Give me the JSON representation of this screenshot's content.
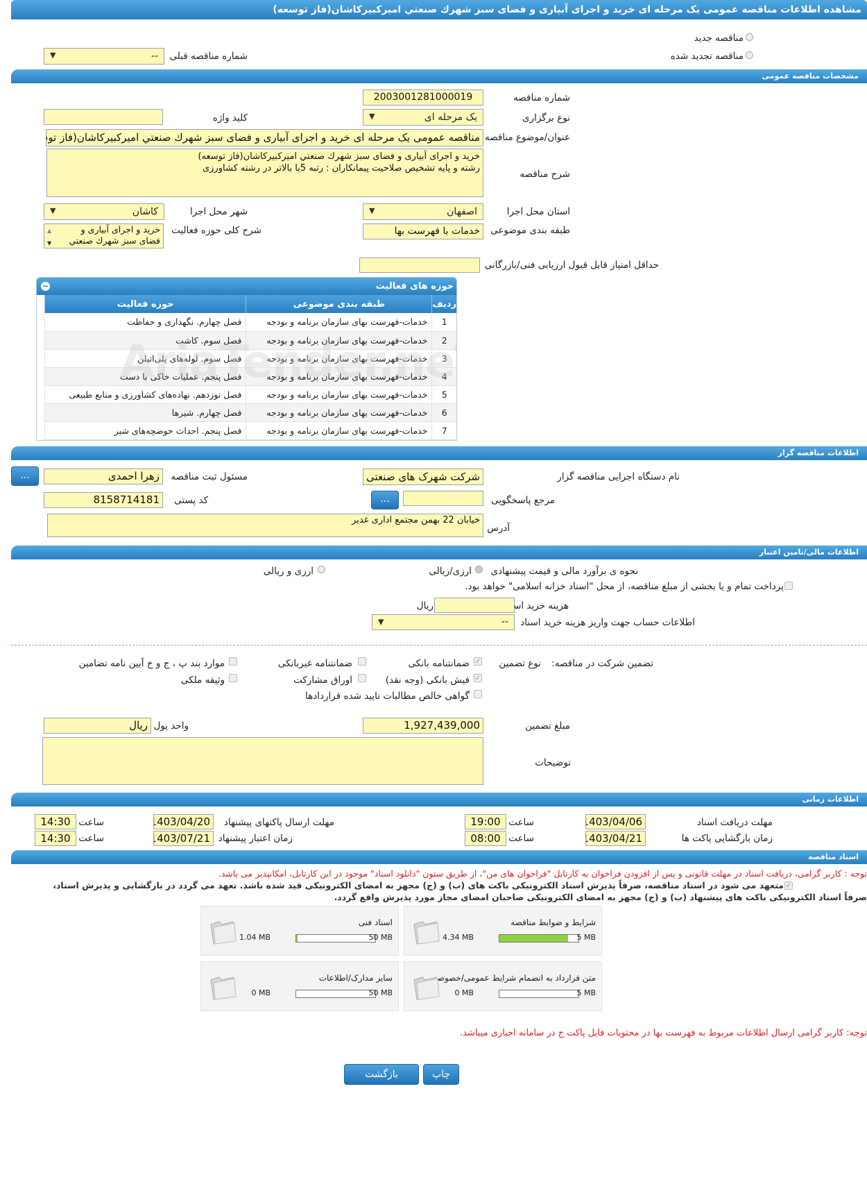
{
  "header": {
    "title": "مشاهده اطلاعات مناقصه عمومی یک مرحله ای خرید و اجرای آبیاری و فضای سبز شهرك صنعتي اميركبيركاشان(فاز توسعه)"
  },
  "mode": {
    "new": "مناقصه جدید",
    "renewed": "مناقصه تجدید شده",
    "prev_label": "شماره مناقصه قبلی",
    "prev_value": "--"
  },
  "general": {
    "section": "مشخصات مناقصه عمومی",
    "number_label": "شماره مناقصه",
    "number": "2003001281000019",
    "type_label": "نوع برگزاری",
    "type": "یک مرحله ای",
    "keyword_label": "کلید واژه",
    "keyword": "",
    "subject_label": "عنوان/موضوع مناقصه",
    "subject": "مناقصه عمومی یک مرحله ای خرید و اجرای آبیاری و فضای سبز شهرك صنعتي اميركبيركاشان(فاز توسعه)",
    "desc_label": "شرح مناقصه",
    "desc_line1": "خرید و اجرای آبیاری و فضای سبز شهرك صنعتي اميركبيركاشان(فاز توسعه)",
    "desc_line2": "رشته و پایه تشخیص صلاحیت پیمانکاران : رتبه 5یا بالاتر در رشته کشاورزی",
    "province_label": "استان محل اجرا",
    "province": "اصفهان",
    "city_label": "شهر محل اجرا",
    "city": "کاشان",
    "category_label": "طبقه بندی موضوعی",
    "category": "خدمات با فهرست بها",
    "activity_label": "شرح کلی حوزه فعالیت",
    "activity_line1": "خرید و اجرای آبیاری و",
    "activity_line2": "فضای سبز شهرك صنعتي",
    "min_score_label": "حداقل امتیاز قابل قبول ارزیابی فنی/بازرگانی",
    "min_score": ""
  },
  "activities": {
    "title": "حوزه های فعالیت",
    "headers": [
      "ردیف",
      "طبقه بندی موضوعی",
      "حوزه فعالیت"
    ],
    "rows": [
      [
        "1",
        "خدمات-فهرست بهای سازمان برنامه و بودجه",
        "فصل چهارم. نگهداری و حفاظت"
      ],
      [
        "2",
        "خدمات-فهرست بهای سازمان برنامه و بودجه",
        "فصل سوم. کاشت"
      ],
      [
        "3",
        "خدمات-فهرست بهای سازمان برنامه و بودجه",
        "فصل سوم. لوله‌های پلی‌اتیلن"
      ],
      [
        "4",
        "خدمات-فهرست بهای سازمان برنامه و بودجه",
        "فصل پنجم. عملیات خاکی با دست"
      ],
      [
        "5",
        "خدمات-فهرست بهای سازمان برنامه و بودجه",
        "فصل  نوزدهم. نهاده‌های کشاورزی و منابع طبیعی"
      ],
      [
        "6",
        "خدمات-فهرست بهای سازمان برنامه و بودجه",
        "فصل چهارم. شیرها"
      ],
      [
        "7",
        "خدمات-فهرست بهای سازمان برنامه و بودجه",
        "فصل پنجم. احداث حوضچه‌های شیر"
      ]
    ],
    "watermark": "AriaTender.neT"
  },
  "organizer": {
    "section": "اطلاعات مناقصه گزار",
    "org_label": "نام دستگاه اجرایی مناقصه گزار",
    "org": "شرکت شهرک های صنعتی",
    "officer_label": "مسئول ثبت مناقصه",
    "officer": "زهرا احمدی",
    "ref_label": "مرجع پاسخگویی",
    "ref": "",
    "postal_label": "کد پستی",
    "postal": "8158714181",
    "address_label": "آدرس",
    "address": "خیابان 22 بهمن مجتمع اداری غدیر",
    "more": "..."
  },
  "finance": {
    "section": "اطلاعات مالی/تامین اعتبار",
    "method_label": "نحوه ی برآورد مالی و قیمت پیشنهادی",
    "opt1": "ارزی/ریالی",
    "opt2": "ارزی و ریالی",
    "treasury": "پرداخت تمام و یا بخشی از مبلغ مناقصه، از محل \"اسناد خزانه اسلامی\" خواهد بود.",
    "doc_fee_label": "هزینه خرید اسناد",
    "doc_fee": "",
    "doc_fee_unit": "ریال",
    "account_label": "اطلاعات حساب جهت واریز هزینه خرید اسناد",
    "account": "--"
  },
  "guarantee": {
    "title": "تضمین شرکت در مناقصه:",
    "type_label": "نوع تضمین",
    "bank": "ضمانتنامه بانکی",
    "nonbank": "ضمانتنامه غیربانکی",
    "cases": "موارد بند پ ، ج و خ آیین نامه تضامین",
    "cash": "فیش بانکی (وجه نقد)",
    "bonds": "اوراق مشارکت",
    "property": "وثیقه ملکی",
    "claims": "گواهی خالص مطالبات تایید شده قراردادها",
    "amount_label": "مبلغ تضمین",
    "amount": "1,927,439,000",
    "currency_label": "واحد پول",
    "currency": "ریال",
    "notes_label": "توضیحات",
    "notes": ""
  },
  "timing": {
    "section": "اطلاعات زمانی",
    "receive_label": "مهلت دریافت اسناد",
    "receive_date": "1403/04/06",
    "receive_time": "19:00",
    "send_label": "مهلت ارسال پاکتهای پیشنهاد",
    "send_date": "1403/04/20",
    "send_time": "14:30",
    "open_label": "زمان بازگشایی پاکت ها",
    "open_date": "1403/04/21",
    "open_time": "08:00",
    "valid_label": "زمان اعتبار پیشنهاد",
    "valid_date": "1403/07/21",
    "valid_time": "14:30",
    "time_label": "ساعت"
  },
  "docs": {
    "section": "اسناد مناقصه",
    "note1": "توجه : کاربر گرامی، دریافت اسناد در مهلت قانونی و پس از افزودن فراخوان به کارتابل \"فراخوان های من\"، از طریق ستون \"دانلود اسناد\" موجود در این کارتابل، امکانپذیر می باشد.",
    "commit1": "متعهد می شود در اسناد مناقصه، صرفاً پذیرش اسناد الکترونیکی باکت های (ب) و (ج) مجهز به امضای الکترونیکی قید شده باشد. تعهد می گردد در بارگشایی و پذیرش اسناد،",
    "commit2": "صرفاً اسناد الکترونیکی باکت های پیشنهاد (ب) و (ج) مجهز به امضای الکترونیکی صاحبان امضای مجاز مورد پذیرش واقع گردد.",
    "files": [
      {
        "name": "شرایط و ضوابط مناقصه",
        "used": "4.34 MB",
        "max": "5 MB",
        "ratio": 0.868
      },
      {
        "name": "اسناد فنی",
        "used": "1.04 MB",
        "max": "50 MB",
        "ratio": 0.0208
      },
      {
        "name": "متن قرارداد به انضمام شرایط عمومی/خصوصی",
        "used": "0 MB",
        "max": "5 MB",
        "ratio": 0
      },
      {
        "name": "سایر مدارک/اطلاعات",
        "used": "0 MB",
        "max": "50 MB",
        "ratio": 0
      }
    ],
    "note2": "توجه: کاربر گرامی ارسال اطلاعات مربوط به فهرست بها در محتویات فایل پاکت ج در سامانه اجباری میباشد."
  },
  "actions": {
    "print": "چاپ",
    "back": "بازگشت"
  }
}
